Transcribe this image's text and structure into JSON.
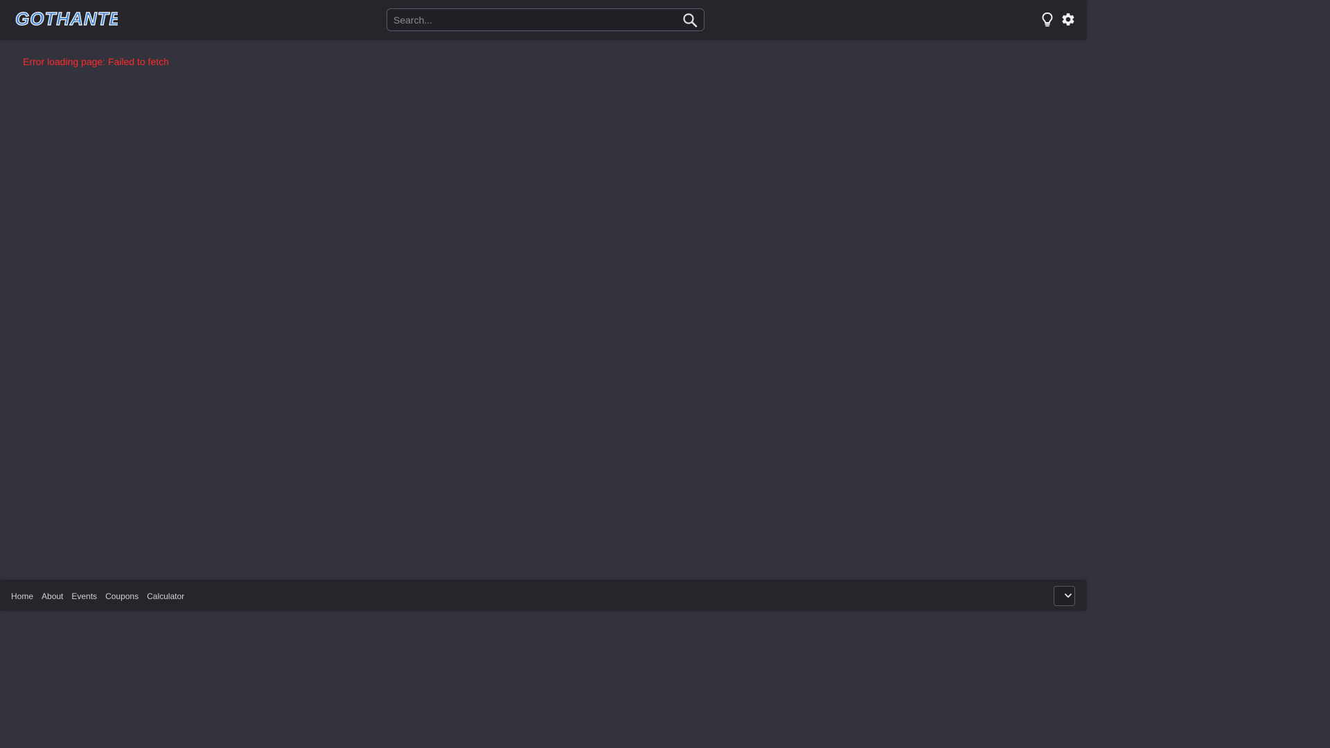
{
  "header": {
    "logo_text": "GOTHANTE",
    "search": {
      "placeholder": "Search...",
      "value": ""
    },
    "icons": {
      "search": "search-icon",
      "theme": "lightbulb-icon",
      "settings": "gear-icon"
    }
  },
  "main": {
    "error_message": "Error loading page: Failed to fetch"
  },
  "footer": {
    "links": [
      "Home",
      "About",
      "Events",
      "Coupons",
      "Calculator"
    ],
    "language_select": {
      "value": "",
      "icon": "chevron-down-icon"
    }
  },
  "colors": {
    "background": "#33333d",
    "bar": "#25252b",
    "error": "#ff2a2a",
    "logo_blue": "#3b82d6"
  }
}
